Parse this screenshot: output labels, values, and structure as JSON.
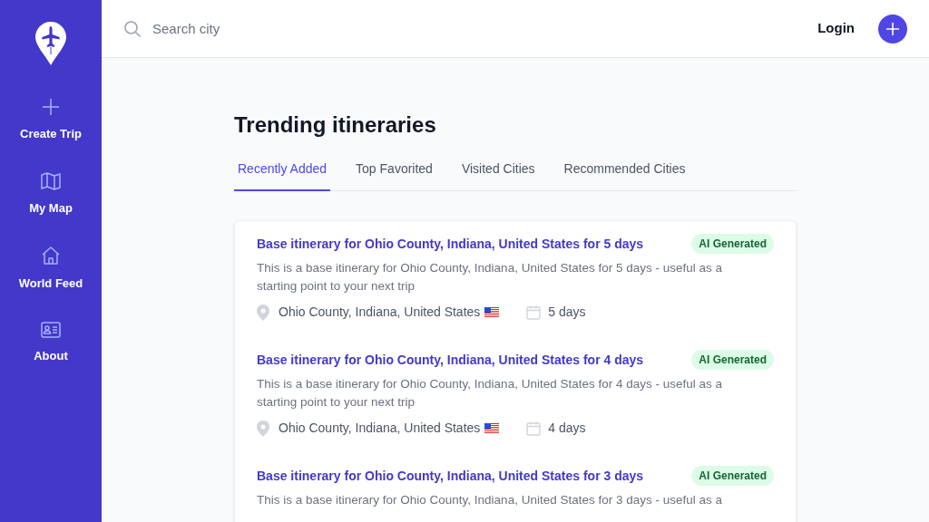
{
  "sidebar": {
    "items": [
      {
        "kind": "plus",
        "label": "Create Trip"
      },
      {
        "kind": "map",
        "label": "My Map"
      },
      {
        "kind": "home",
        "label": "World Feed"
      },
      {
        "kind": "card",
        "label": "About"
      }
    ]
  },
  "header": {
    "search": {
      "placeholder": "Search city"
    },
    "login": "Login"
  },
  "title": "Trending itineraries",
  "tabs": [
    {
      "label": "Recently Added",
      "selected": true
    },
    {
      "label": "Top Favorited",
      "selected": false
    },
    {
      "label": "Visited Cities",
      "selected": false
    },
    {
      "label": "Recommended Cities",
      "selected": false
    }
  ],
  "itineraries": [
    {
      "title": "Base itinerary for Ohio County, Indiana, United States for 5 days",
      "badge": "AI Generated",
      "description": "This is a base itinerary for Ohio County, Indiana, United States for 5 days - useful as a starting point to your next trip",
      "location": "Ohio County, Indiana, United States",
      "duration": "5 days"
    },
    {
      "title": "Base itinerary for Ohio County, Indiana, United States for 4 days",
      "badge": "AI Generated",
      "description": "This is a base itinerary for Ohio County, Indiana, United States for 4 days - useful as a starting point to your next trip",
      "location": "Ohio County, Indiana, United States",
      "duration": "4 days"
    },
    {
      "title": "Base itinerary for Ohio County, Indiana, United States for 3 days",
      "badge": "AI Generated",
      "description": "This is a base itinerary for Ohio County, Indiana, United States for 3 days - useful as a"
    }
  ]
}
